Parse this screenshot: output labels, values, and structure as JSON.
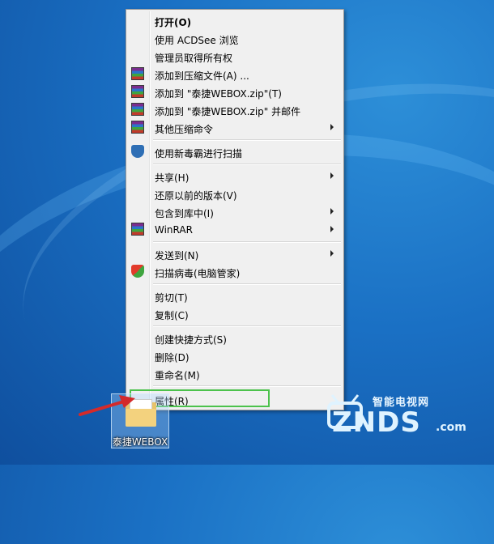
{
  "context_menu": {
    "items": [
      {
        "label": "打开(O)",
        "bold": true
      },
      {
        "label": "使用 ACDSee 浏览"
      },
      {
        "label": "管理员取得所有权"
      },
      {
        "label": "添加到压缩文件(A) ...",
        "icon": "winrar-archive-icon"
      },
      {
        "label": "添加到 \"泰捷WEBOX.zip\"(T)",
        "icon": "winrar-archive-icon"
      },
      {
        "label": "添加到 \"泰捷WEBOX.zip\" 并邮件",
        "icon": "winrar-archive-icon"
      },
      {
        "label": "其他压缩命令",
        "icon": "winrar-archive-icon",
        "submenu": true
      },
      {
        "label": "使用新毒霸进行扫描",
        "icon": "duba-shield-icon"
      },
      {
        "label": "共享(H)",
        "submenu": true
      },
      {
        "label": "还原以前的版本(V)"
      },
      {
        "label": "包含到库中(I)",
        "submenu": true
      },
      {
        "label": "WinRAR",
        "icon": "winrar-icon",
        "submenu": true
      },
      {
        "label": "发送到(N)",
        "submenu": true
      },
      {
        "label": "扫描病毒(电脑管家)",
        "icon": "pc-guard-icon"
      },
      {
        "label": "剪切(T)"
      },
      {
        "label": "复制(C)"
      },
      {
        "label": "创建快捷方式(S)"
      },
      {
        "label": "删除(D)"
      },
      {
        "label": "重命名(M)"
      },
      {
        "label": "属性(R)",
        "highlighted": true
      }
    ]
  },
  "desktop_icon": {
    "label": "泰捷WEBOX"
  },
  "watermark": {
    "sub": "智能电视网",
    "main": "ZNDS",
    "suffix": ".com"
  },
  "colors": {
    "highlight_box": "#4cc24c",
    "arrow": "#d42a2a",
    "menu_bg": "#f0f0f0"
  }
}
